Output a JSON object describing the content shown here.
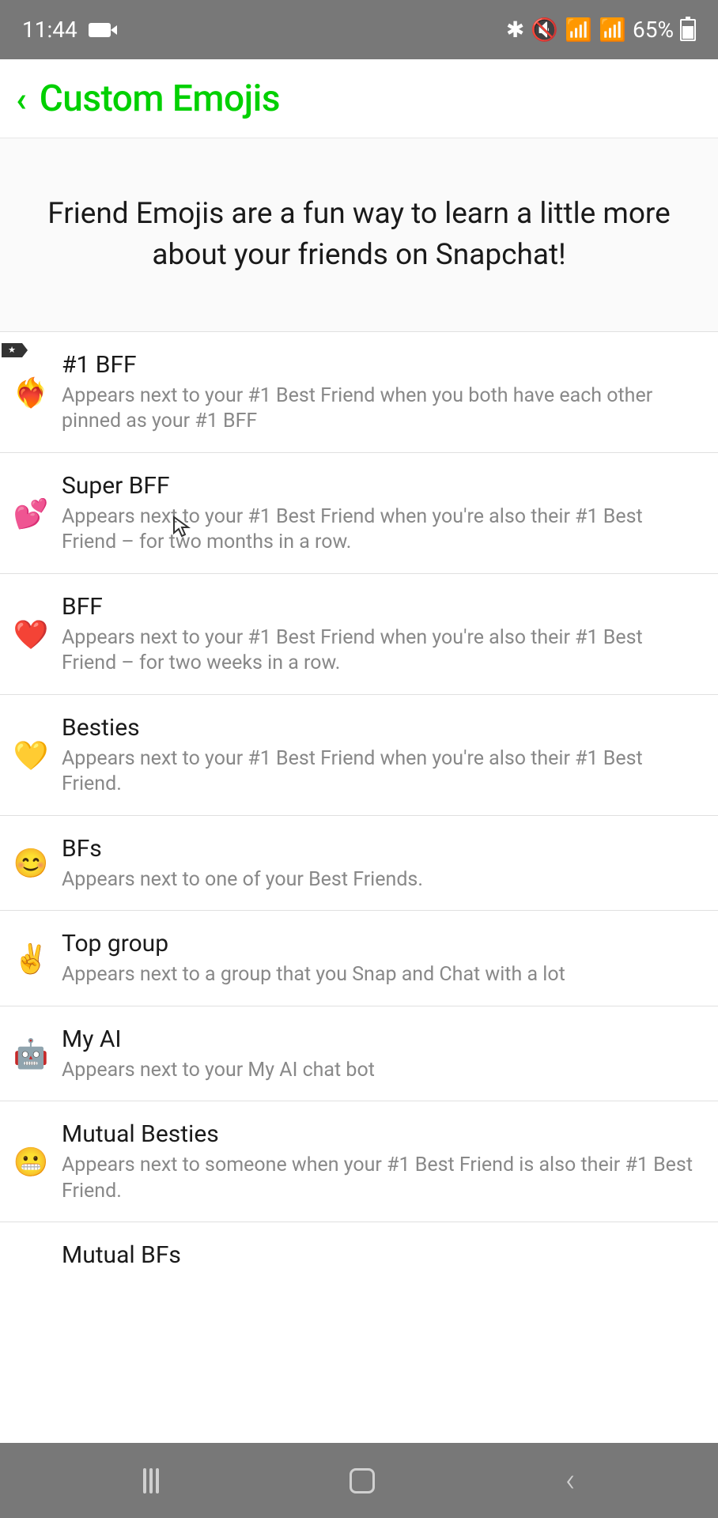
{
  "status_bar": {
    "time": "11:44",
    "battery": "65%"
  },
  "header": {
    "title": "Custom Emojis"
  },
  "intro": "Friend Emojis are a fun way to learn a little more about your friends on Snapchat!",
  "items": [
    {
      "emoji": "❤️‍🔥",
      "title": "#1 BFF",
      "desc": "Appears next to your #1 Best Friend when you both have each other pinned as your #1 BFF",
      "hasPin": true
    },
    {
      "emoji": "💕",
      "title": "Super BFF",
      "desc": "Appears next to your #1 Best Friend when you're also their #1 Best Friend – for two months in a row."
    },
    {
      "emoji": "❤️",
      "title": "BFF",
      "desc": "Appears next to your #1 Best Friend when you're also their #1 Best Friend – for two weeks in a row."
    },
    {
      "emoji": "💛",
      "title": "Besties",
      "desc": "Appears next to your #1 Best Friend when you're also their #1 Best Friend."
    },
    {
      "emoji": "😊",
      "title": "BFs",
      "desc": "Appears next to one of your Best Friends."
    },
    {
      "emoji": "✌️",
      "title": "Top group",
      "desc": "Appears next to a group that you Snap and Chat with a lot"
    },
    {
      "emoji": "🤖",
      "title": "My AI",
      "desc": "Appears next to your My AI chat bot"
    },
    {
      "emoji": "😬",
      "title": "Mutual Besties",
      "desc": "Appears next to someone when your #1 Best Friend is also their #1 Best Friend."
    }
  ],
  "partial_item": {
    "title": "Mutual BFs"
  }
}
